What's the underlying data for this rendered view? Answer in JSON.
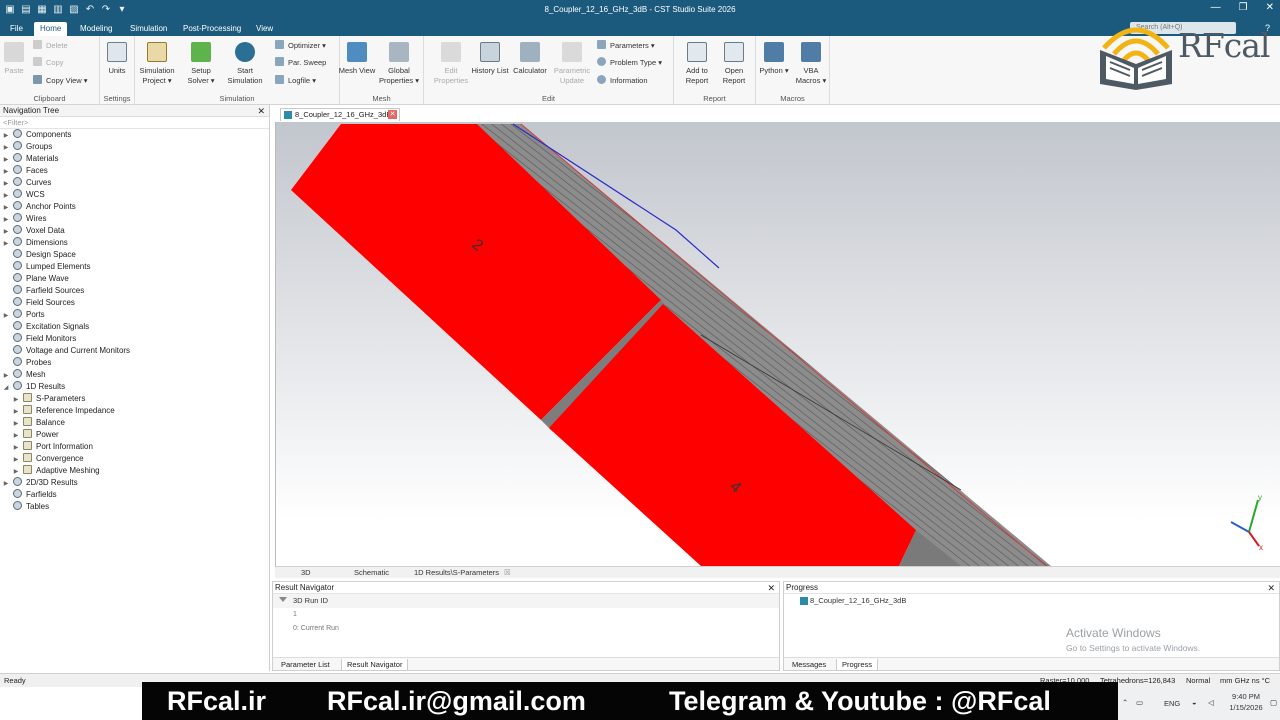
{
  "window": {
    "title": "8_Coupler_12_16_GHz_3dB - CST Studio Suite 2026",
    "search_placeholder": "Search (Alt+Q)"
  },
  "menu_tabs": [
    "File",
    "Home",
    "Modeling",
    "Simulation",
    "Post-Processing",
    "View"
  ],
  "active_tab": "Home",
  "ribbon": {
    "clipboard": {
      "label": "Clipboard",
      "paste": "Paste",
      "delete": "Delete",
      "copy": "Copy",
      "copy_view": "Copy View"
    },
    "settings": {
      "label": "Settings",
      "units": "Units"
    },
    "simulation": {
      "label": "Simulation",
      "sim_project": "Simulation Project",
      "setup_solver": "Setup Solver",
      "start_sim": "Start Simulation",
      "optimizer": "Optimizer",
      "par_sweep": "Par. Sweep",
      "logfile": "Logfile"
    },
    "mesh": {
      "label": "Mesh",
      "mesh_view": "Mesh View",
      "global_props": "Global Properties"
    },
    "edit": {
      "label": "Edit",
      "edit_props": "Edit Properties",
      "history": "History List",
      "calculator": "Calculator",
      "param_update": "Parametric Update",
      "parameters": "Parameters",
      "problem_type": "Problem Type",
      "information": "Information"
    },
    "report": {
      "label": "Report",
      "add_to_report": "Add to Report",
      "open_report": "Open Report"
    },
    "macros": {
      "label": "Macros",
      "python": "Python",
      "vba": "VBA Macros"
    }
  },
  "logo": {
    "text": "RFcal"
  },
  "nav": {
    "title": "Navigation Tree",
    "filter": "<Filter>",
    "items": [
      {
        "label": "Components",
        "level": 0
      },
      {
        "label": "Groups",
        "level": 0
      },
      {
        "label": "Materials",
        "level": 0
      },
      {
        "label": "Faces",
        "level": 0
      },
      {
        "label": "Curves",
        "level": 0
      },
      {
        "label": "WCS",
        "level": 0
      },
      {
        "label": "Anchor Points",
        "level": 0
      },
      {
        "label": "Wires",
        "level": 0
      },
      {
        "label": "Voxel Data",
        "level": 0
      },
      {
        "label": "Dimensions",
        "level": 0
      },
      {
        "label": "Design Space",
        "level": 0
      },
      {
        "label": "Lumped Elements",
        "level": 0
      },
      {
        "label": "Plane Wave",
        "level": 0
      },
      {
        "label": "Farfield Sources",
        "level": 0
      },
      {
        "label": "Field Sources",
        "level": 0
      },
      {
        "label": "Ports",
        "level": 0
      },
      {
        "label": "Excitation Signals",
        "level": 0
      },
      {
        "label": "Field Monitors",
        "level": 0
      },
      {
        "label": "Voltage and Current Monitors",
        "level": 0
      },
      {
        "label": "Probes",
        "level": 0
      },
      {
        "label": "Mesh",
        "level": 0
      },
      {
        "label": "1D Results",
        "level": 0
      },
      {
        "label": "S-Parameters",
        "level": 1
      },
      {
        "label": "Reference Impedance",
        "level": 1
      },
      {
        "label": "Balance",
        "level": 1
      },
      {
        "label": "Power",
        "level": 1
      },
      {
        "label": "Port Information",
        "level": 1
      },
      {
        "label": "Convergence",
        "level": 1
      },
      {
        "label": "Adaptive Meshing",
        "level": 1
      },
      {
        "label": "2D/3D Results",
        "level": 0
      },
      {
        "label": "Farfields",
        "level": 0
      },
      {
        "label": "Tables",
        "level": 0
      }
    ]
  },
  "document_tab": "8_Coupler_12_16_GHz_3dB",
  "viewport": {
    "port_labels": [
      "2",
      "4"
    ]
  },
  "view_tabs": [
    "3D",
    "Schematic",
    "1D Results\\S-Parameters"
  ],
  "result_navigator": {
    "title": "Result Navigator",
    "column": "3D Run ID",
    "rows": [
      "1",
      "0: Current Run"
    ],
    "tabs": [
      "Parameter List",
      "Result Navigator"
    ]
  },
  "progress": {
    "title": "Progress",
    "item": "8_Coupler_12_16_GHz_3dB",
    "tabs": [
      "Messages",
      "Progress"
    ]
  },
  "activate": {
    "line1": "Activate Windows",
    "line2": "Go to Settings to activate Windows."
  },
  "status": {
    "left": "Ready",
    "raster": "Raster=10.000",
    "tetra": "Tetrahedrons=126,843",
    "mode": "Normal",
    "units": "mm  GHz  ns  °C"
  },
  "banner": {
    "site": "RFcal.ir",
    "email": "RFcal.ir@gmail.com",
    "social": "Telegram & Youtube : @RFcal"
  },
  "tray": {
    "lang": "ENG",
    "time": "9:40 PM",
    "date": "1/15/2026"
  },
  "colors": {
    "titlebar": "#1b5a7c",
    "model_red": "#ff0000",
    "substrate": "#8a8a8a"
  }
}
